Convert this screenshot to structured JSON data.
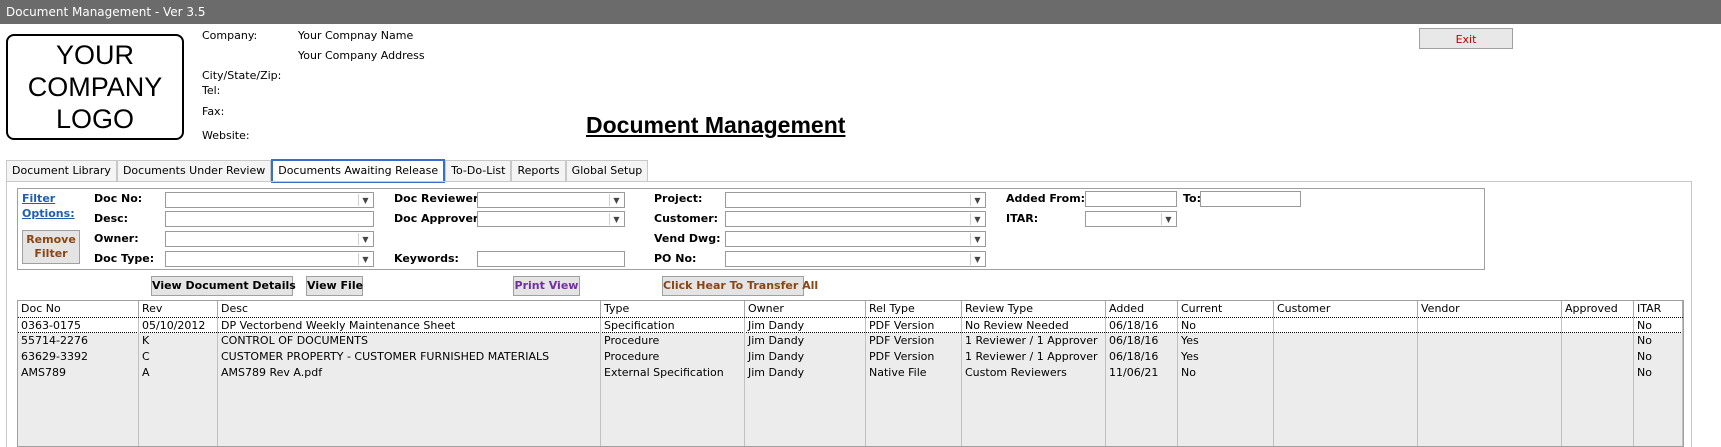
{
  "window": {
    "title": "Document Management - Ver 3.5"
  },
  "logo": {
    "text": "YOUR\nCOMPANY\nLOGO"
  },
  "company": {
    "company_label": "Company:",
    "company_name": "Your Compnay Name",
    "company_address": "Your Company Address",
    "city_label": "City/State/Zip:",
    "tel_label": "Tel:",
    "fax_label": "Fax:",
    "website_label": "Website:"
  },
  "page_title": "Document Management",
  "exit_label": "Exit",
  "tabs": [
    {
      "label": "Document Library",
      "active": false
    },
    {
      "label": "Documents Under Review",
      "active": false
    },
    {
      "label": "Documents Awaiting Release",
      "active": true
    },
    {
      "label": "To-Do-List",
      "active": false
    },
    {
      "label": "Reports",
      "active": false
    },
    {
      "label": "Global Setup",
      "active": false
    }
  ],
  "filters": {
    "filter_options_line1": "Filter",
    "filter_options_line2": "Options:",
    "remove_filter_line1": "Remove",
    "remove_filter_line2": "Filter",
    "doc_no_label": "Doc No:",
    "desc_label": "Desc:",
    "owner_label": "Owner:",
    "doc_type_label": "Doc Type:",
    "doc_reviewer_label": "Doc Reviewer:",
    "doc_approver_label": "Doc Approver:",
    "keywords_label": "Keywords:",
    "project_label": "Project:",
    "customer_label": "Customer:",
    "vend_dwg_label": "Vend Dwg:",
    "po_no_label": "PO No:",
    "added_from_label": "Added From:",
    "to_label": "To:",
    "itar_label": "ITAR:"
  },
  "actions": {
    "view_details": "View Document Details",
    "view_file": "View File",
    "print_view": "Print View",
    "transfer_all": "Click Hear To Transfer All"
  },
  "table": {
    "columns": [
      "Doc No",
      "Rev",
      "Desc",
      "Type",
      "Owner",
      "Rel Type",
      "Review Type",
      "Added",
      "Current",
      "Customer",
      "Vendor",
      "Approved",
      "ITAR"
    ],
    "rows": [
      [
        "0363-0175",
        "05/10/2012",
        "DP Vectorbend Weekly Maintenance Sheet",
        "Specification",
        "Jim Dandy",
        "PDF Version",
        "No Review Needed",
        "06/18/16",
        "No",
        "",
        "",
        "",
        "No"
      ],
      [
        "55714-2276",
        "K",
        "CONTROL OF DOCUMENTS",
        "Procedure",
        "Jim Dandy",
        "PDF Version",
        "1 Reviewer / 1 Approver",
        "06/18/16",
        "Yes",
        "",
        "",
        "",
        "No"
      ],
      [
        "63629-3392",
        "C",
        "CUSTOMER PROPERTY - CUSTOMER FURNISHED MATERIALS",
        "Procedure",
        "Jim Dandy",
        "PDF Version",
        "1 Reviewer / 1 Approver",
        "06/18/16",
        "Yes",
        "",
        "",
        "",
        "No"
      ],
      [
        "AMS789",
        "A",
        "AMS789 Rev A.pdf",
        "External Specification",
        "Jim Dandy",
        "Native File",
        "Custom Reviewers",
        "11/06/21",
        "No",
        "",
        "",
        "",
        "No"
      ]
    ]
  },
  "colors": {
    "titlebar": "#6b6b6b",
    "exit_text": "#c00000",
    "link": "#1f5fb0",
    "print_view": "#7030a0",
    "transfer": "#8b4513",
    "active_tab_border": "#3b6ec9"
  },
  "icons": {
    "combo_arrow": "chevron-down-icon"
  }
}
